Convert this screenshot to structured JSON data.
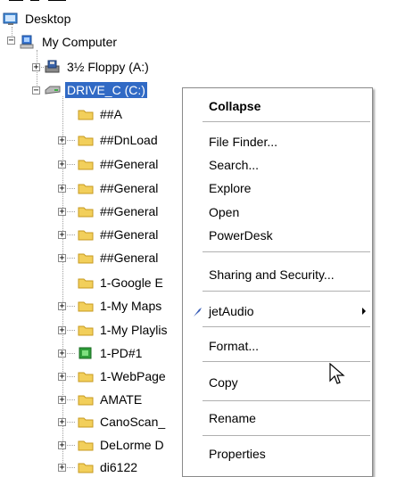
{
  "tree": {
    "root": "Desktop",
    "my_computer": "My Computer",
    "floppy": "3½ Floppy (A:)",
    "drive_c": "DRIVE_C (C:)",
    "folders": [
      "##A",
      "##DnLoad",
      "##General",
      "##General",
      "##General",
      "##General",
      "##General",
      "1-Google E",
      "1-My Maps",
      "1-My Playlis",
      "1-PD#1",
      "1-WebPage",
      "AMATE",
      "CanoScan_",
      "DeLorme D",
      "di6122"
    ]
  },
  "context_menu": {
    "collapse": "Collapse",
    "file_finder": "File Finder...",
    "search": "Search...",
    "explore": "Explore",
    "open": "Open",
    "powerdesk": "PowerDesk",
    "sharing": "Sharing and Security...",
    "jetaudio": "jetAudio",
    "format": "Format...",
    "copy": "Copy",
    "rename": "Rename",
    "properties": "Properties"
  },
  "colors": {
    "selection": "#316ac5",
    "folder": "#f2cf5b"
  }
}
